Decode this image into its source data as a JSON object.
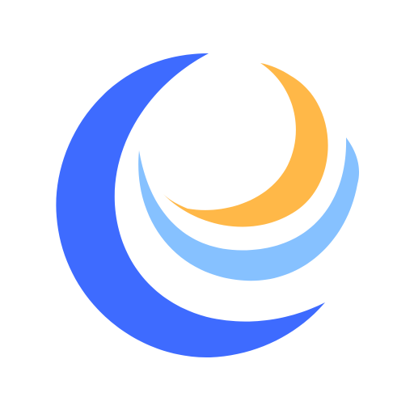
{
  "logo": {
    "icon": "crescent-moon-logo-icon",
    "colors": {
      "background": "#ffffff",
      "outer_crescent": "#3E6BFF",
      "middle_crescent": "#86C1FF",
      "inner_crescent": "#FFB848"
    }
  }
}
